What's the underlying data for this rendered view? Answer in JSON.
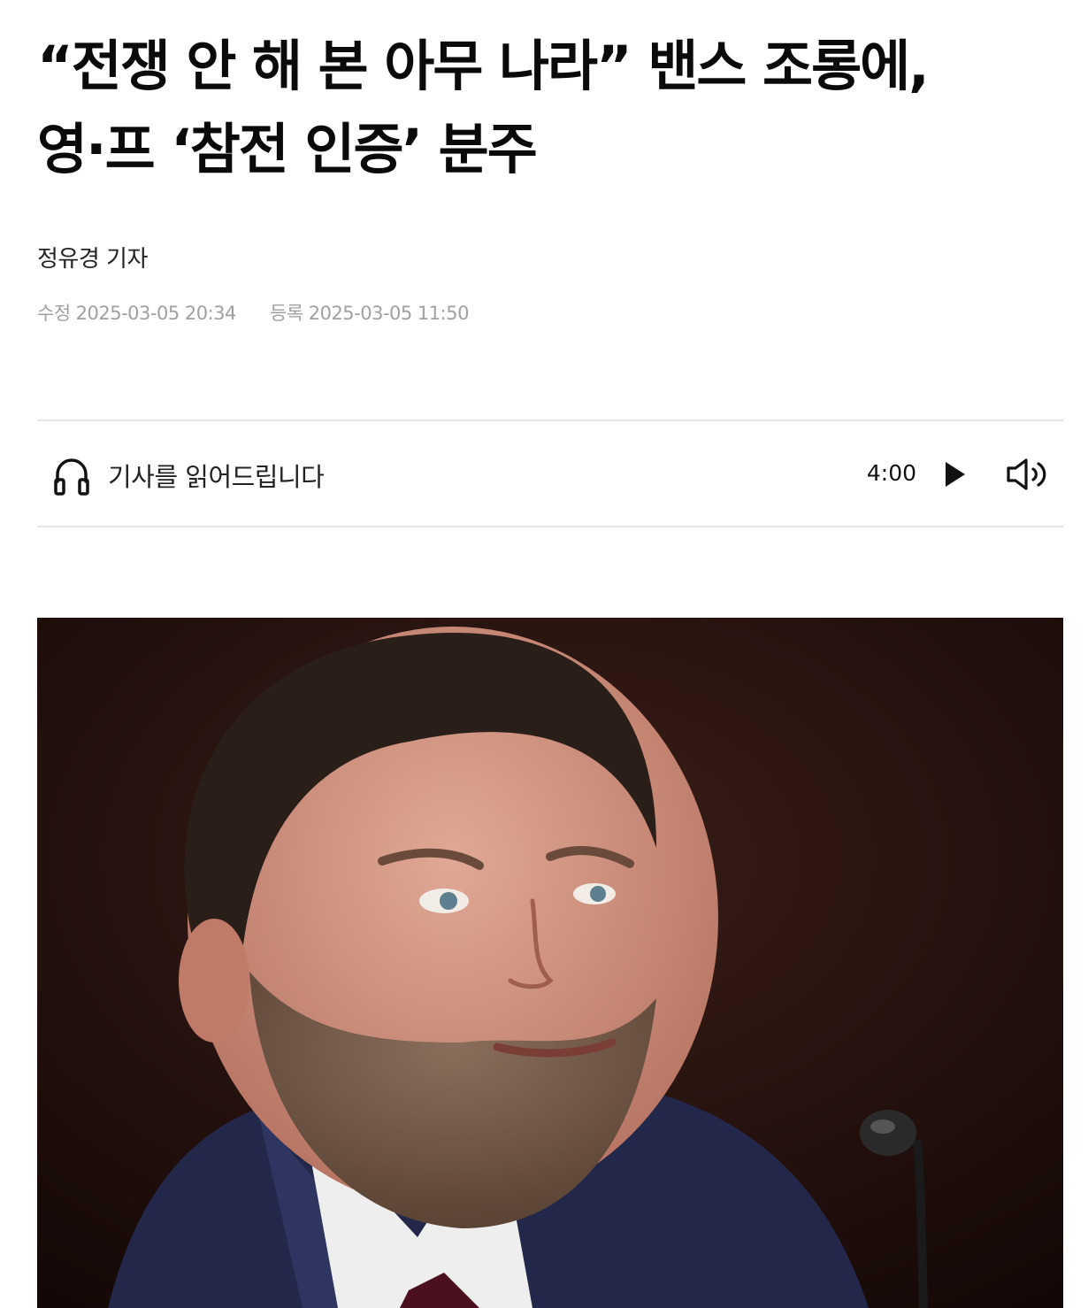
{
  "article": {
    "headline_line1": "“전쟁 안 해 본 아무 나라” 밴스 조롱에,",
    "headline_line2": "영·프 ‘참전 인증’ 분주",
    "author": "정유경 기자",
    "modified_label": "수정",
    "modified_date": "2025-03-05 20:34",
    "registered_label": "등록",
    "registered_date": "2025-03-05 11:50"
  },
  "tts": {
    "label": "기사를 읽어드립니다",
    "duration": "4:00",
    "icons": {
      "headphone": "headphone-icon",
      "play": "play-icon",
      "volume": "volume-icon"
    }
  },
  "colors": {
    "headline": "#0a0a0a",
    "meta_gray": "#a0a0a0",
    "divider": "#e6e6e6",
    "photo_background": "#2a1612"
  }
}
